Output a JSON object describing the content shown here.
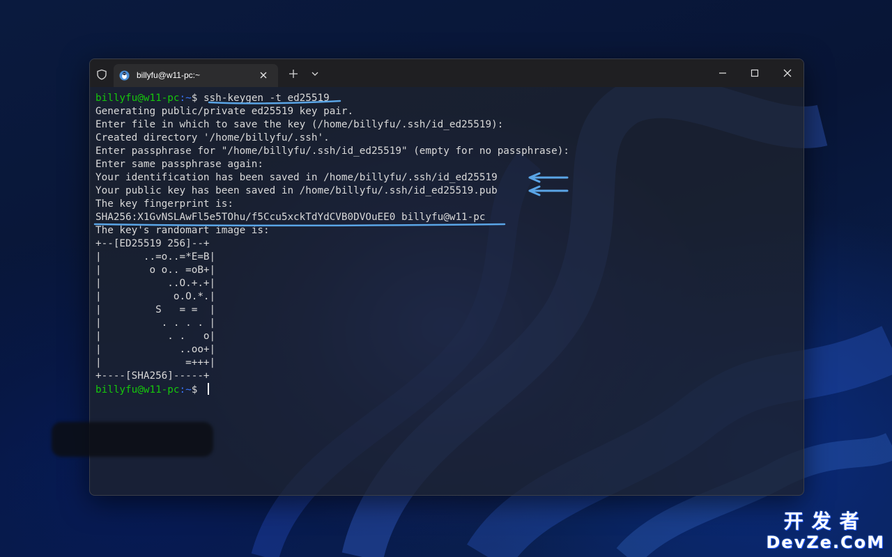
{
  "window": {
    "tab_title": "billyfu@w11-pc:~",
    "icons": {
      "shield": "shield-icon",
      "tab": "linux-penguin-icon",
      "close_tab": "close-icon",
      "new_tab": "plus-icon",
      "dropdown": "chevron-down-icon",
      "minimize": "minimize-icon",
      "maximize": "maximize-icon",
      "close_window": "close-icon"
    }
  },
  "terminal": {
    "prompt_user": "billyfu@w11-pc",
    "prompt_path": ":~",
    "prompt_symbol": "$ ",
    "command": "ssh-keygen -t ed25519",
    "output": [
      "Generating public/private ed25519 key pair.",
      "Enter file in which to save the key (/home/billyfu/.ssh/id_ed25519):",
      "Created directory '/home/billyfu/.ssh'.",
      "Enter passphrase for \"/home/billyfu/.ssh/id_ed25519\" (empty for no passphrase):",
      "Enter same passphrase again:",
      "Your identification has been saved in /home/billyfu/.ssh/id_ed25519",
      "Your public key has been saved in /home/billyfu/.ssh/id_ed25519.pub",
      "The key fingerprint is:",
      "SHA256:X1GvNSLAwFl5e5TOhu/f5Ccu5xckTdYdCVB0DVOuEE0 billyfu@w11-pc",
      "The key's randomart image is:",
      "+--[ED25519 256]--+",
      "|       ..=o..=*E=B|",
      "|        o o.. =oB+|",
      "|           ..O.+.+|",
      "|            o.O.*.|",
      "|         S   = =  |",
      "|          . . . . |",
      "|           . .   o|",
      "|             ..oo+|",
      "|              =+++|",
      "+----[SHA256]-----+"
    ]
  },
  "annotation_color": "#5aa5e6",
  "watermark": {
    "top": "开发者",
    "bottom": "DevZe.CoM"
  }
}
